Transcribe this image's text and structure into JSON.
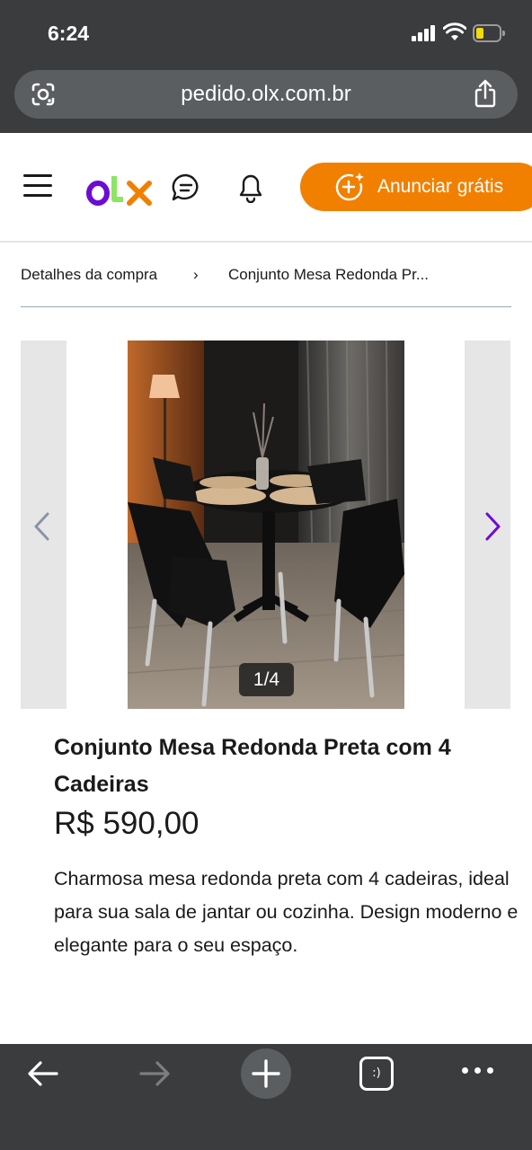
{
  "status_bar": {
    "time": "6:24"
  },
  "browser": {
    "url": "pedido.olx.com.br",
    "tabs_label": ":)"
  },
  "header": {
    "logo": "OLX",
    "announce_label": "Anunciar grátis",
    "colors": {
      "brand_orange": "#f28000",
      "brand_purple": "#6e0ad6",
      "brand_green": "#8ce563"
    }
  },
  "breadcrumb": {
    "items": [
      "Detalhes da compra",
      "Conjunto Mesa Redonda Pr..."
    ],
    "separator": "›"
  },
  "gallery": {
    "counter": "1/4",
    "current": 1,
    "total": 4
  },
  "product": {
    "title": "Conjunto Mesa Redonda Preta com 4 Cadeiras",
    "price": "R$ 590,00",
    "description": "Charmosa mesa redonda preta com 4 cadeiras, ideal para sua sala de jantar ou cozinha. Design moderno e elegante para o seu espaço."
  },
  "toolbar": {
    "icons": [
      "back-arrow-icon",
      "forward-arrow-icon",
      "plus-icon",
      "tabs-icon",
      "more-icon"
    ]
  }
}
